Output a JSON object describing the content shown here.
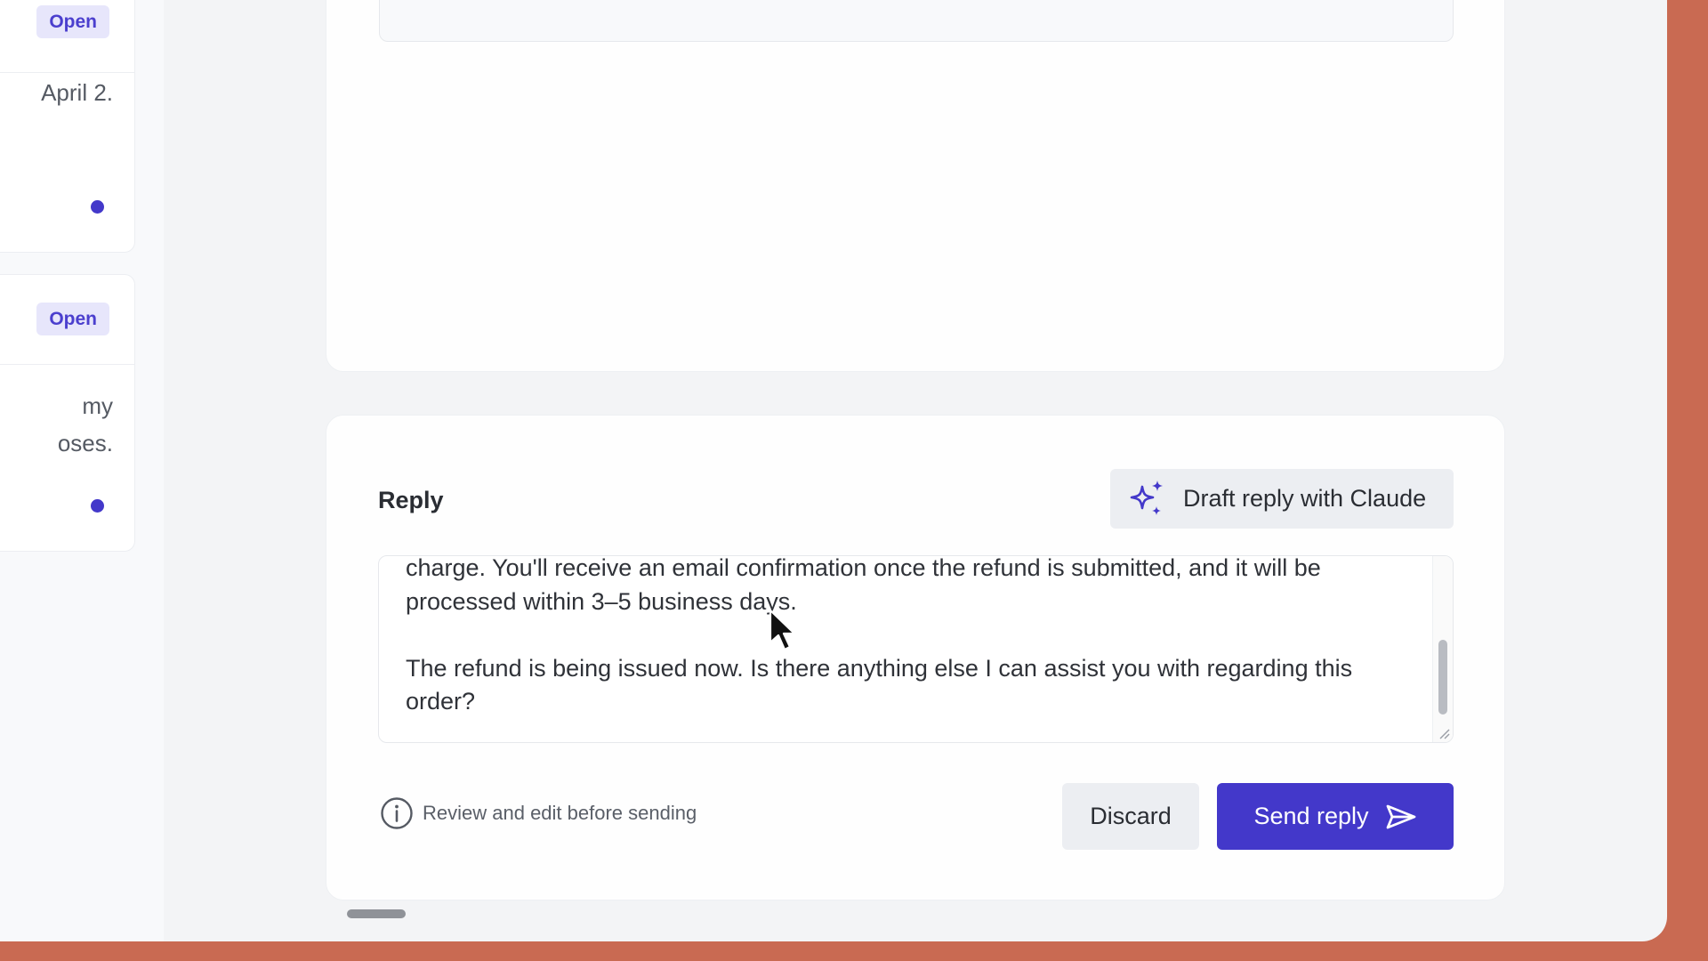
{
  "colors": {
    "accent": "#4338ca",
    "badge_bg": "#e7e6fb",
    "desktop_bg": "#c96a52"
  },
  "ticket_list": {
    "items": [
      {
        "status": "Open",
        "snippet": "April 2.",
        "unread": true
      },
      {
        "status": "Open",
        "snippet": "my\noses.",
        "unread": true
      }
    ]
  },
  "reply": {
    "title": "Reply",
    "draft_button_label": "Draft reply with Claude",
    "draft_icon": "sparkle-icon",
    "body": "charge. You'll receive an email confirmation once the refund is submitted, and it will be processed within 3–5 business days.\n\nThe refund is being issued now. Is there anything else I can assist you with regarding this order?",
    "hint": "Review and edit before sending",
    "hint_icon": "info-icon",
    "discard_label": "Discard",
    "send_label": "Send reply",
    "send_icon": "send-icon"
  }
}
